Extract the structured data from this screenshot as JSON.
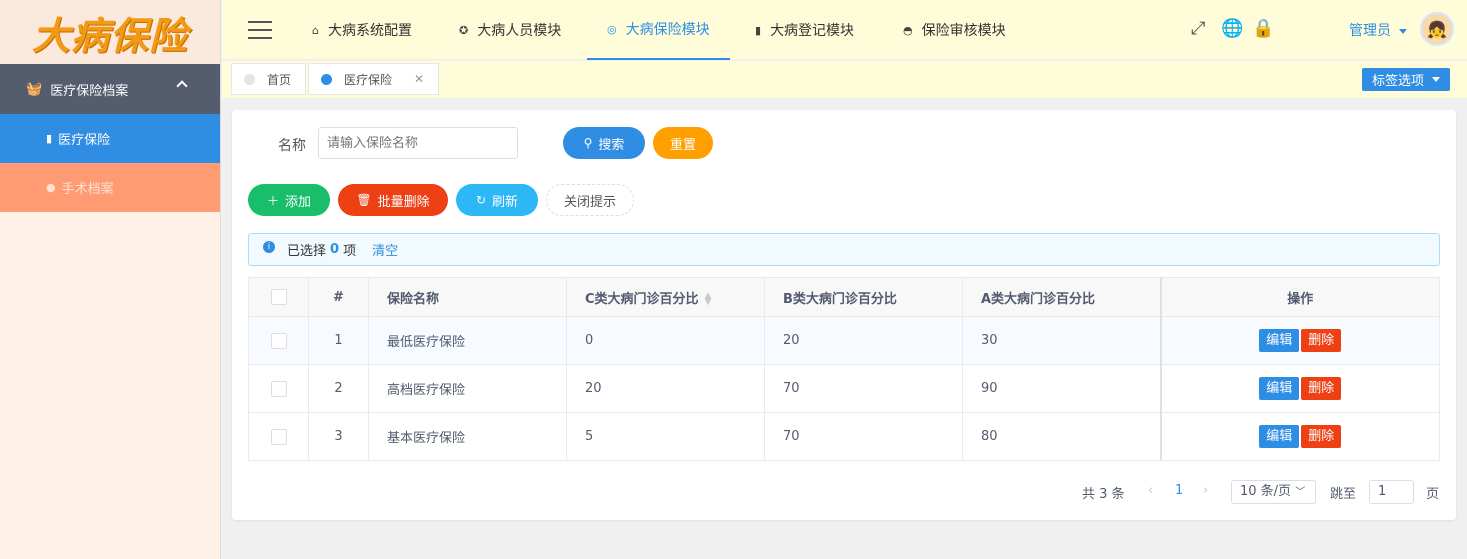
{
  "app": {
    "logo_text": "大病保险"
  },
  "sidebar": {
    "group_label": "医疗保险档案",
    "items": [
      {
        "label": "医疗保险"
      },
      {
        "label": "手术档案"
      }
    ]
  },
  "header": {
    "nav": [
      {
        "label": "大病系统配置",
        "icon": "home-icon"
      },
      {
        "label": "大病人员模块",
        "icon": "team-icon"
      },
      {
        "label": "大病保险模块",
        "icon": "insurance-icon"
      },
      {
        "label": "大病登记模块",
        "icon": "book-icon"
      },
      {
        "label": "保险审核模块",
        "icon": "audit-icon"
      }
    ],
    "admin_label": "管理员"
  },
  "tabs": {
    "items": [
      {
        "label": "首页"
      },
      {
        "label": "医疗保险"
      }
    ],
    "options_label": "标签选项"
  },
  "search": {
    "label": "名称",
    "placeholder": "请输入保险名称",
    "search_label": "搜索",
    "reset_label": "重置"
  },
  "toolbar": {
    "add_label": "添加",
    "batch_delete_label": "批量删除",
    "refresh_label": "刷新",
    "close_tip_label": "关闭提示"
  },
  "selection": {
    "prefix": "已选择",
    "count": "0",
    "suffix": "项",
    "clear_label": "清空"
  },
  "table": {
    "headers": [
      "#",
      "保险名称",
      "C类大病门诊百分比",
      "B类大病门诊百分比",
      "A类大病门诊百分比",
      "操作"
    ],
    "edit_label": "编辑",
    "delete_label": "删除",
    "rows": [
      {
        "idx": "1",
        "name": "最低医疗保险",
        "c": "0",
        "b": "20",
        "a": "30"
      },
      {
        "idx": "2",
        "name": "高档医疗保险",
        "c": "20",
        "b": "70",
        "a": "90"
      },
      {
        "idx": "3",
        "name": "基本医疗保险",
        "c": "5",
        "b": "70",
        "a": "80"
      }
    ]
  },
  "pager": {
    "total_text": "共 3 条",
    "current_page": "1",
    "page_size": "10 条/页",
    "jump_label": "跳至",
    "jump_value": "1",
    "page_unit": "页"
  },
  "colors": {
    "primary": "#2f8de4",
    "success": "#19be6b",
    "danger": "#ed4014",
    "warning": "#ff9f00",
    "info": "#2db7f5"
  }
}
